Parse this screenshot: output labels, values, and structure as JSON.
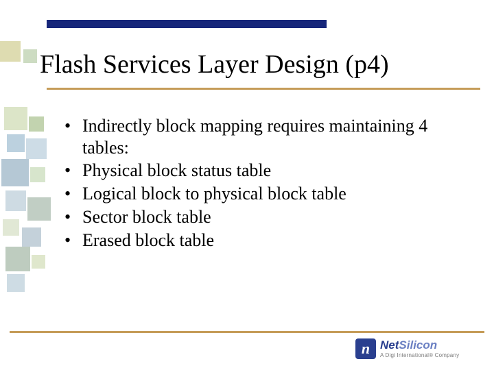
{
  "title": "Flash Services Layer Design (p4)",
  "bullets": [
    "Indirectly block mapping requires maintaining 4 tables:",
    "Physical block status table",
    "Logical block to physical block table",
    "Sector block table",
    "Erased block table"
  ],
  "logo": {
    "mark_glyph": "n",
    "brand_bold": "Net",
    "brand_light": "Silicon",
    "tagline": "A Digi International® Company"
  }
}
